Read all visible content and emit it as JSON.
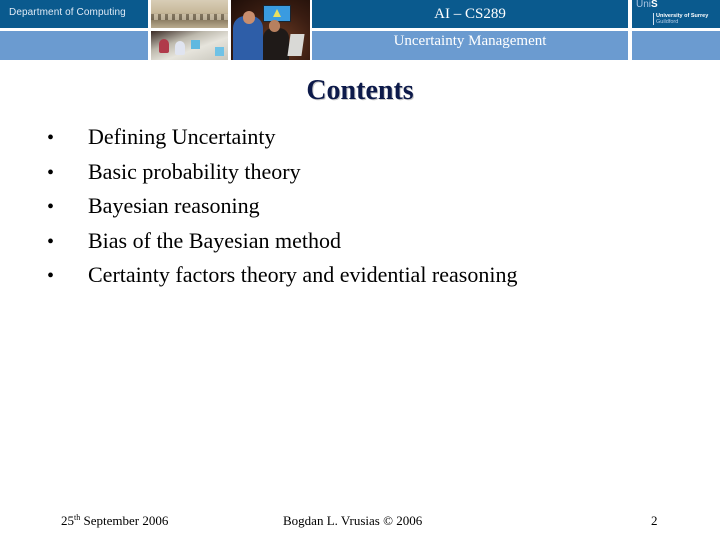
{
  "header": {
    "department": "Department of Computing",
    "course_title": "AI – CS289",
    "course_subtitle": "Uncertainty Management",
    "logo": {
      "uni_thin": "Uni",
      "uni_bold": "S",
      "university_name": "University of Surrey",
      "town": "Guildford"
    },
    "photos": [
      "computer-lab-photo",
      "students-at-computers-photo",
      "students-presentation-photo"
    ],
    "colors": {
      "dark_band": "#0a5a8e",
      "light_band": "#6b9bd0"
    }
  },
  "slide": {
    "title": "Contents",
    "bullet_symbol": "•",
    "bullets": [
      "Defining Uncertainty",
      "Basic probability theory",
      "Bayesian reasoning",
      "Bias of the Bayesian method",
      "Certainty factors theory and evidential reasoning"
    ]
  },
  "footer": {
    "date_day": "25",
    "date_suffix": "th",
    "date_rest": " September 2006",
    "author": "Bogdan L. Vrusias © 2006",
    "page_number": "2"
  }
}
